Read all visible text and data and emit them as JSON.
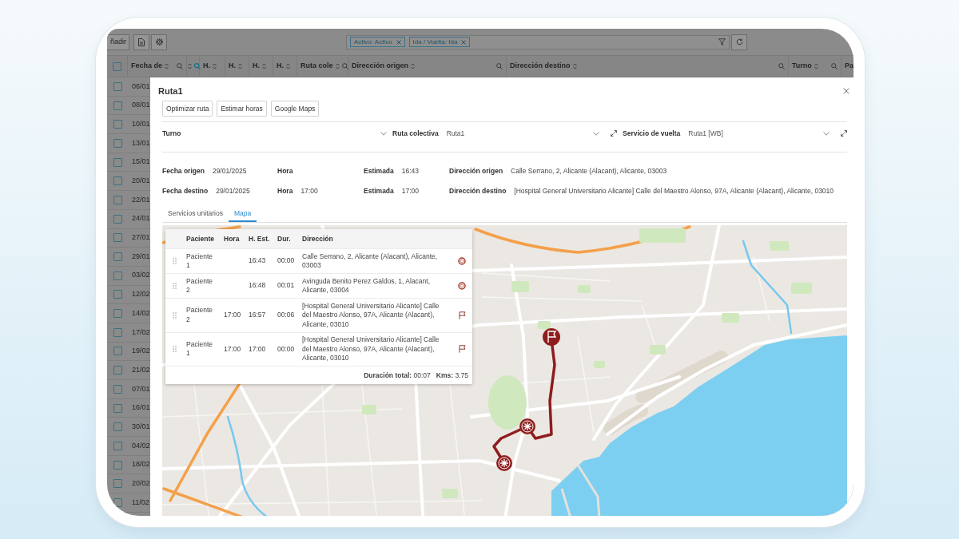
{
  "toolbar": {
    "add_button": "ñadir",
    "filters": [
      {
        "label": "Activo: Activo"
      },
      {
        "label": "Ida / Vuelta: Ida"
      }
    ]
  },
  "grid": {
    "select_all_checked": false,
    "columns": [
      {
        "label": "Fecha de",
        "search": true,
        "active": false
      },
      {
        "search": true,
        "active": true
      },
      {
        "label": "H.",
        "search": false,
        "active": false
      },
      {
        "label": "H.",
        "search": false,
        "active": false
      },
      {
        "label": "H.",
        "search": false,
        "active": false
      },
      {
        "label": "H.",
        "search": false,
        "active": false
      },
      {
        "label": "Ruta cole",
        "search": true,
        "active": false
      },
      {
        "label": "Dirección origen",
        "search": true,
        "active": false
      },
      {
        "label": "Dirección destino",
        "search": true,
        "active": false
      },
      {
        "label": "Turno",
        "search": true,
        "active": false
      },
      {
        "label": "Pa",
        "search": false,
        "active": false
      }
    ],
    "rows": [
      {
        "date": "06/01",
        "checked": false
      },
      {
        "date": "08/01",
        "checked": false
      },
      {
        "date": "10/01",
        "checked": false
      },
      {
        "date": "13/01",
        "checked": false
      },
      {
        "date": "15/01",
        "checked": false
      },
      {
        "date": "20/01",
        "checked": false
      },
      {
        "date": "22/01",
        "checked": false
      },
      {
        "date": "24/01",
        "checked": false
      },
      {
        "date": "27/01",
        "checked": false
      },
      {
        "date": "29/01",
        "checked": false
      },
      {
        "date": "03/02",
        "checked": false
      },
      {
        "date": "12/02",
        "checked": false
      },
      {
        "date": "14/02",
        "checked": false
      },
      {
        "date": "17/02",
        "checked": false
      },
      {
        "date": "19/02",
        "checked": false
      },
      {
        "date": "21/02",
        "checked": false
      },
      {
        "date": "07/01",
        "checked": false
      },
      {
        "date": "16/01",
        "checked": false
      },
      {
        "date": "30/01",
        "checked": false
      },
      {
        "date": "04/02",
        "checked": false
      },
      {
        "date": "18/02",
        "checked": false
      },
      {
        "date": "20/02",
        "checked": false
      },
      {
        "date": "11/02",
        "checked": false
      }
    ]
  },
  "dialog": {
    "title": "Ruta1",
    "actions": [
      "Optimizar ruta",
      "Estimar horas",
      "Google Maps"
    ],
    "selects": [
      {
        "label": "Turno",
        "expandable": false
      },
      {
        "label": "Ruta colectiva",
        "value": "Ruta1",
        "expandable": true
      },
      {
        "label": "Servicio de vuelta",
        "value": "Ruta1 [WB]",
        "expandable": true
      }
    ],
    "details": [
      {
        "fields": [
          {
            "label": "Fecha origen",
            "value": "29/01/2025"
          },
          {
            "label": "Hora"
          },
          {
            "label": "Estimada",
            "value": "16:43"
          },
          {
            "label": "Dirección origen",
            "value": "Calle Serrano, 2, Alicante (Alacant), Alicante, 03003"
          }
        ]
      },
      {
        "fields": [
          {
            "label": "Fecha destino",
            "value": "29/01/2025"
          },
          {
            "label": "Hora",
            "value": "17:00"
          },
          {
            "label": "Estimada",
            "value": "17:00"
          },
          {
            "label": "Dirección destino",
            "value": "[Hospital General Universitario Alicante] Calle del Maestro Alonso, 97A, Alicante (Alacant), Alicante, 03010"
          }
        ]
      }
    ],
    "tabs": [
      {
        "label": "Servicios unitarios",
        "selected": false
      },
      {
        "label": "Mapa",
        "selected": true
      }
    ],
    "stops": {
      "columns": [
        "Paciente",
        "Hora",
        "H. Est.",
        "Dur.",
        "Dirección"
      ],
      "rows": [
        {
          "patient": "Paciente 1",
          "est": "16:43",
          "dur": "00:00",
          "address": "Calle Serrano, 2, Alicante (Alacant), Alicante, 03003",
          "kind": "origin"
        },
        {
          "patient": "Paciente 2",
          "est": "16:48",
          "dur": "00:01",
          "address": "Avinguda Benito Perez Galdos, 1, Alacant, Alicante, 03004",
          "kind": "origin"
        },
        {
          "patient": "Paciente 2",
          "time": "17:00",
          "est": "16:57",
          "dur": "00:06",
          "address": "[Hospital General Universitario Alicante] Calle del Maestro Alonso, 97A, Alicante (Alacant), Alicante, 03010",
          "kind": "destination"
        },
        {
          "patient": "Paciente 1",
          "time": "17:00",
          "est": "17:00",
          "dur": "00:00",
          "address": "[Hospital General Universitario Alicante] Calle del Maestro Alonso, 97A, Alicante (Alacant), Alicante, 03010",
          "kind": "destination"
        }
      ],
      "totals": [
        "**Duración total:** 00:07",
        "**Kms:** 3.75"
      ]
    }
  }
}
